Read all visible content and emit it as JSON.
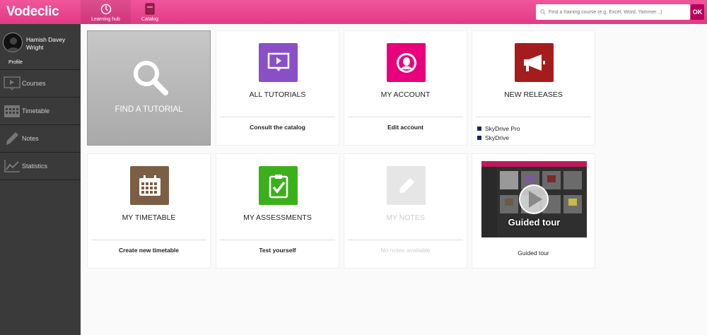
{
  "header": {
    "logo": "Vodeclic",
    "nav": [
      {
        "label": "Learning hub",
        "icon": "compass-icon"
      },
      {
        "label": "Catalog",
        "icon": "book-icon"
      }
    ],
    "search_placeholder": "Find a training course (e.g. Excel, Word, Yammer...)",
    "ok_label": "OK"
  },
  "sidebar": {
    "user_name": "Hamish Davey Wright",
    "profile_label": "Profile",
    "items": [
      {
        "label": "Courses",
        "icon": "video-icon"
      },
      {
        "label": "Timetable",
        "icon": "calendar-icon"
      },
      {
        "label": "Notes",
        "icon": "pencil-icon"
      },
      {
        "label": "Statistics",
        "icon": "chart-icon"
      }
    ]
  },
  "tiles": {
    "find": {
      "title": "FIND A TUTORIAL",
      "icon": "search-icon"
    },
    "tutorials": {
      "title": "ALL TUTORIALS",
      "sub": "Consult the catalog",
      "color": "#8a4fc4",
      "icon": "presentation-icon"
    },
    "account": {
      "title": "MY ACCOUNT",
      "sub": "Edit account",
      "color": "#e8007d",
      "icon": "user-icon"
    },
    "releases": {
      "title": "NEW RELEASES",
      "color": "#a51c1c",
      "icon": "megaphone-icon",
      "items": [
        "SkyDrive Pro",
        "SkyDrive"
      ]
    },
    "timetable": {
      "title": "MY TIMETABLE",
      "sub": "Create new timetable",
      "color": "#7b5f44",
      "icon": "calendar-icon"
    },
    "assessments": {
      "title": "MY ASSESSMENTS",
      "sub": "Test yourself",
      "color": "#3cb01b",
      "icon": "clipboard-check-icon"
    },
    "notes": {
      "title": "MY NOTES",
      "sub": "No notes available",
      "color": "#e6e6e6",
      "icon": "pencil-icon"
    },
    "tour": {
      "overlay": "Guided tour",
      "sub": "Guided tour",
      "icon": "play-icon"
    }
  }
}
